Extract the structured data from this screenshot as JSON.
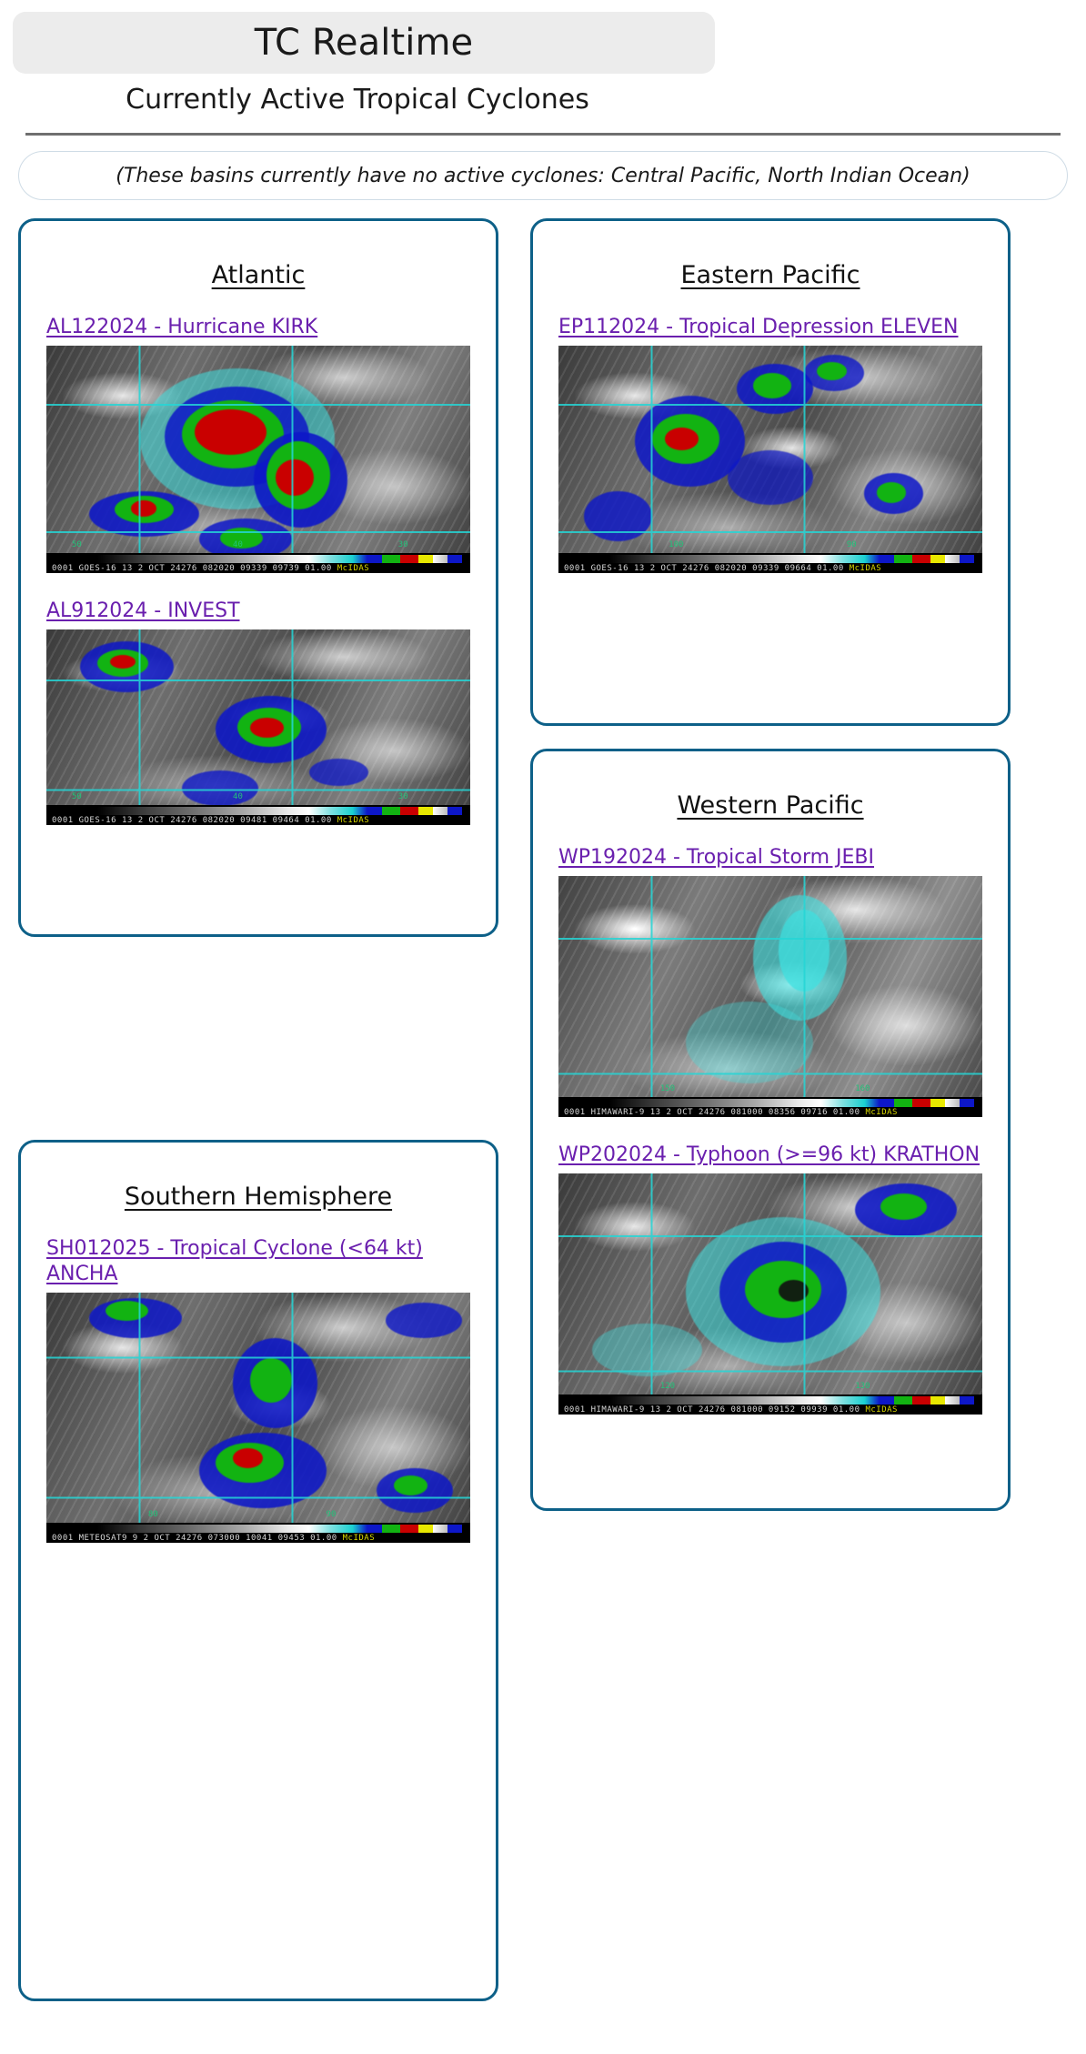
{
  "header": {
    "title": "TC Realtime",
    "subtitle": "Currently Active Tropical Cyclones"
  },
  "notice": {
    "text": "(These basins currently have no active cyclones: Central Pacific, North Indian Ocean)"
  },
  "colors": {
    "panel_border": "#0d6088",
    "link": "#6a1fae",
    "header_pill_bg": "#ececec",
    "rule": "#6f6f6f",
    "notice_border": "#cfdce6"
  },
  "basins": [
    {
      "id": "atlantic",
      "title": "Atlantic",
      "storms": [
        {
          "label": "AL122024 - Hurricane KIRK",
          "image_caption": "0001 GOES-16   13   2 OCT 24276 082020 09339 09739 01.00",
          "image_source": "McIDAS",
          "ticks": [
            "50",
            "40",
            "30"
          ]
        },
        {
          "label": "AL912024 - INVEST",
          "image_caption": "0001 GOES-16   13   2 OCT 24276 082020 09481 09464 01.00",
          "image_source": "McIDAS",
          "ticks": [
            "50",
            "40",
            "30"
          ]
        }
      ]
    },
    {
      "id": "eastern-pacific",
      "title": "Eastern Pacific",
      "storms": [
        {
          "label": "EP112024 - Tropical Depression ELEVEN",
          "image_caption": "0001 GOES-16   13   2 OCT 24276 082020 09339 09664 01.00",
          "image_source": "McIDAS",
          "ticks": [
            "100",
            "90"
          ]
        }
      ]
    },
    {
      "id": "western-pacific",
      "title": "Western Pacific",
      "storms": [
        {
          "label": "WP192024 - Tropical Storm JEBI",
          "image_caption": "0001 HIMAWARI-9  13   2 OCT 24276 081000 08356 09716 01.00",
          "image_source": "McIDAS",
          "ticks": [
            "150",
            "160"
          ]
        },
        {
          "label": "WP202024 - Typhoon (>=96 kt) KRATHON",
          "image_caption": "0001 HIMAWARI-9  13   2 OCT 24276 081000 09152 09939 01.00",
          "image_source": "McIDAS",
          "ticks": [
            "120",
            "130"
          ]
        }
      ]
    },
    {
      "id": "southern-hemisphere",
      "title": "Southern Hemisphere",
      "storms": [
        {
          "label": "SH012025 - Tropical Cyclone (<64 kt) ANCHA",
          "image_caption": "0001 METEOSAT9    9   2 OCT 24276 073000 10041 09453 01.00",
          "image_source": "McIDAS",
          "ticks": [
            "80",
            "90"
          ]
        }
      ]
    }
  ]
}
